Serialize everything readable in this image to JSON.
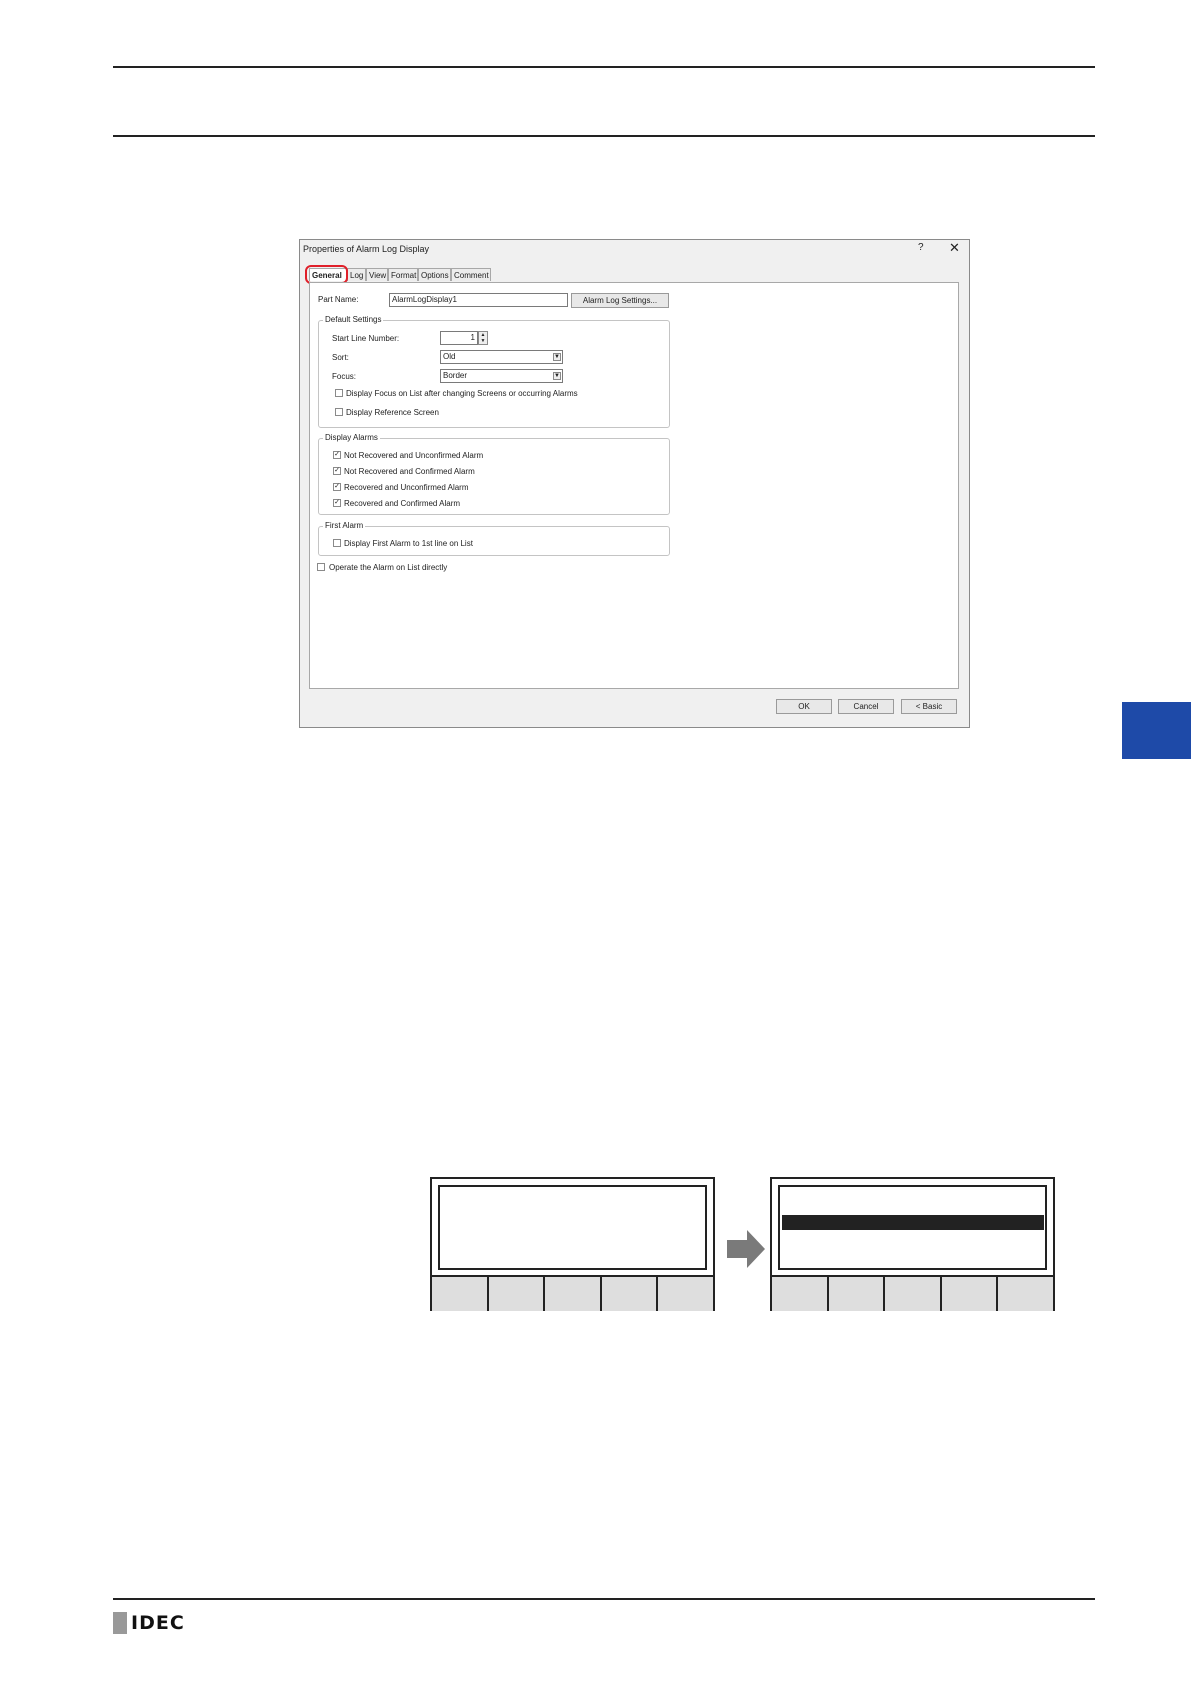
{
  "dialog": {
    "title": "Properties of Alarm Log Display",
    "help_label": "?",
    "close_label": "✕",
    "tabs": [
      "General",
      "Log",
      "View",
      "Format",
      "Options",
      "Comment"
    ],
    "part_name_label": "Part Name:",
    "part_name_value": "AlarmLogDisplay1",
    "alarm_log_settings_button": "Alarm Log Settings...",
    "default_settings": {
      "title": "Default Settings",
      "start_line_label": "Start Line Number:",
      "start_line_value": "1",
      "sort_label": "Sort:",
      "sort_value": "Old",
      "focus_label": "Focus:",
      "focus_value": "Border",
      "focus_after_label": "Display Focus on List after changing Screens or occurring Alarms",
      "reference_label": "Display Reference Screen"
    },
    "display_alarms": {
      "title": "Display Alarms",
      "items": [
        "Not Recovered and Unconfirmed Alarm",
        "Not Recovered and Confirmed Alarm",
        "Recovered and Unconfirmed Alarm",
        "Recovered and Confirmed Alarm"
      ]
    },
    "first_alarm": {
      "title": "First Alarm",
      "item": "Display First Alarm to 1st line on List"
    },
    "operate_label": "Operate the Alarm on List directly",
    "ok_button": "OK",
    "cancel_button": "Cancel",
    "basic_button": "< Basic"
  },
  "logo": {
    "text": "IDEC"
  },
  "colors": {
    "accent_tab": "#1e4aa8",
    "highlight": "#e0202a"
  }
}
